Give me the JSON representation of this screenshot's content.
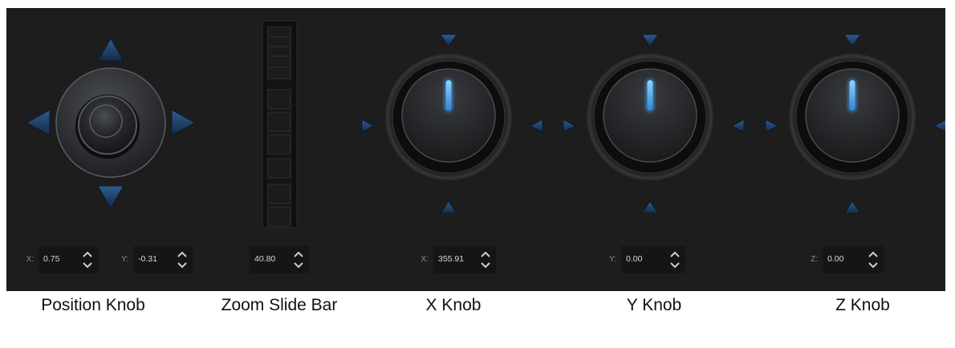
{
  "position_knob": {
    "x": {
      "label": "X:",
      "value": "0.75"
    },
    "y": {
      "label": "Y:",
      "value": "-0.31"
    },
    "caption": "Position Knob"
  },
  "zoom_slider": {
    "value": {
      "label": "",
      "value": "40.80"
    },
    "caption": "Zoom Slide Bar"
  },
  "x_knob": {
    "field": {
      "label": "X:",
      "value": "355.91"
    },
    "caption": "X Knob"
  },
  "y_knob": {
    "field": {
      "label": "Y:",
      "value": "0.00"
    },
    "caption": "Y Knob"
  },
  "z_knob": {
    "field": {
      "label": "Z:",
      "value": "0.00"
    },
    "caption": "Z Knob"
  },
  "colors": {
    "panel": "#1d1d1d",
    "arrow_blue": "#1e3f66",
    "indicator_glow": "#6ec0ff"
  },
  "icons": [
    "triangle-arrow-icon",
    "spinner-up-icon",
    "spinner-down-icon",
    "knob-indicator-icon"
  ]
}
